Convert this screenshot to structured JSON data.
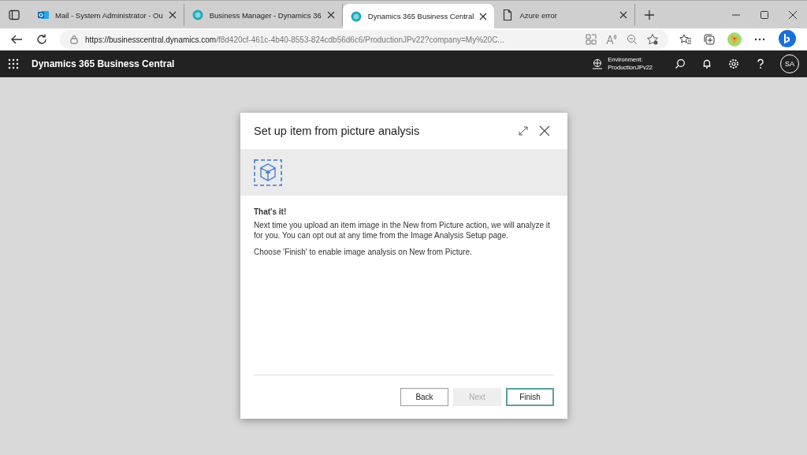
{
  "browser": {
    "tabs": [
      {
        "title": "Mail - System Administrator - Ou",
        "kind": "mail",
        "selected": false
      },
      {
        "title": "Business Manager - Dynamics 36",
        "kind": "dynamics",
        "selected": false
      },
      {
        "title": "Dynamics 365 Business Central",
        "kind": "dynamics",
        "selected": true
      },
      {
        "title": "Azure error",
        "kind": "page",
        "selected": false
      }
    ],
    "address": {
      "host": "https://businesscentral.dynamics.com",
      "path": "/f8d420cf-461c-4b40-8553-824cdb56d6c6/ProductionJPv22?company=My%20C..."
    }
  },
  "app_bar": {
    "title": "Dynamics 365 Business Central",
    "environment_label": "Environment:",
    "environment": "ProductionJPv22",
    "avatar": "SA"
  },
  "dialog": {
    "title": "Set up item from picture analysis",
    "heading": "That's it!",
    "paragraphs": [
      "Next time you upload an item image in the New from Picture action, we will analyze it for you. You can opt out at any time from the Image Analysis Setup page.",
      "Choose 'Finish' to enable image analysis on New from Picture."
    ],
    "buttons": [
      {
        "label": "Back",
        "disabled": false,
        "selected": false
      },
      {
        "label": "Next",
        "disabled": true,
        "selected": false
      },
      {
        "label": "Finish",
        "disabled": false,
        "selected": true
      }
    ]
  }
}
